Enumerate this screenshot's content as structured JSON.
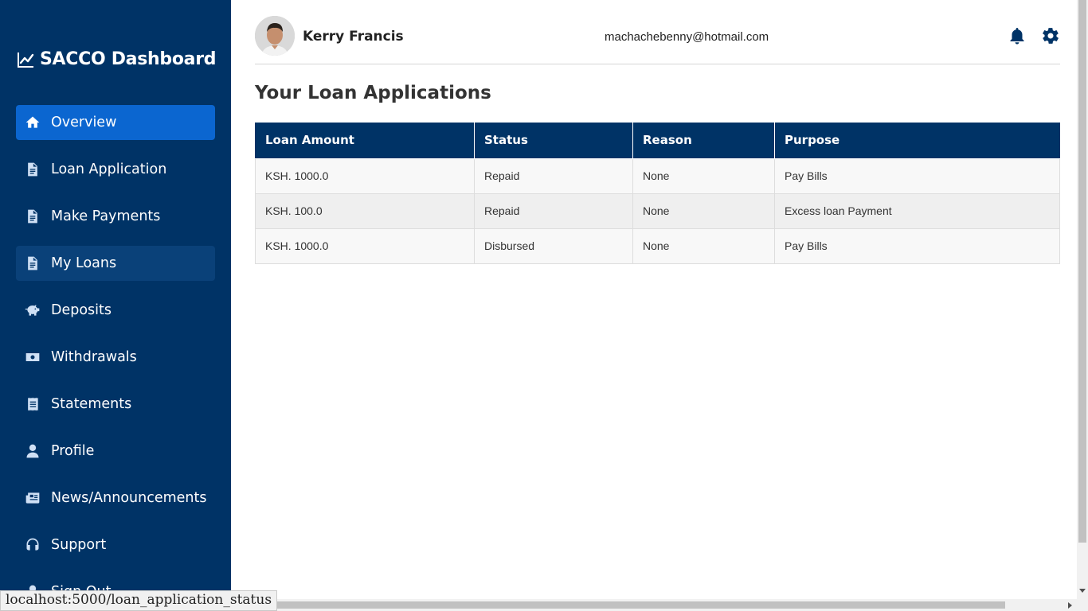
{
  "brand": {
    "title": "SACCO Dashboard",
    "icon": "chart-line-icon"
  },
  "nav": [
    {
      "label": "Overview",
      "icon": "home-icon",
      "state": "active"
    },
    {
      "label": "Loan Application",
      "icon": "file-icon",
      "state": ""
    },
    {
      "label": "Make Payments",
      "icon": "file-icon",
      "state": ""
    },
    {
      "label": "My Loans",
      "icon": "file-icon",
      "state": "highlight"
    },
    {
      "label": "Deposits",
      "icon": "piggy-bank-icon",
      "state": ""
    },
    {
      "label": "Withdrawals",
      "icon": "money-bill-icon",
      "state": ""
    },
    {
      "label": "Statements",
      "icon": "receipt-icon",
      "state": ""
    },
    {
      "label": "Profile",
      "icon": "user-icon",
      "state": ""
    },
    {
      "label": "News/Announcements",
      "icon": "newspaper-icon",
      "state": ""
    },
    {
      "label": "Support",
      "icon": "headset-icon",
      "state": ""
    },
    {
      "label": "Sign Out",
      "icon": "sign-out-icon",
      "state": ""
    }
  ],
  "user": {
    "name": "Kerry Francis",
    "email": "machachebenny@hotmail.com"
  },
  "header_icons": {
    "notifications": "bell-icon",
    "settings": "gear-icon"
  },
  "page": {
    "title": "Your Loan Applications"
  },
  "loans_table": {
    "columns": [
      "Loan Amount",
      "Status",
      "Reason",
      "Purpose"
    ],
    "rows": [
      [
        "KSH. 1000.0",
        "Repaid",
        "None",
        "Pay Bills"
      ],
      [
        "KSH. 100.0",
        "Repaid",
        "None",
        "Excess loan Payment"
      ],
      [
        "KSH. 1000.0",
        "Disbursed",
        "None",
        "Pay Bills"
      ]
    ]
  },
  "status_bar": {
    "url": "localhost:5000/loan_application_status"
  },
  "colors": {
    "sidebar": "#003366",
    "active_nav": "#0b66d0",
    "table_header": "#003366"
  }
}
